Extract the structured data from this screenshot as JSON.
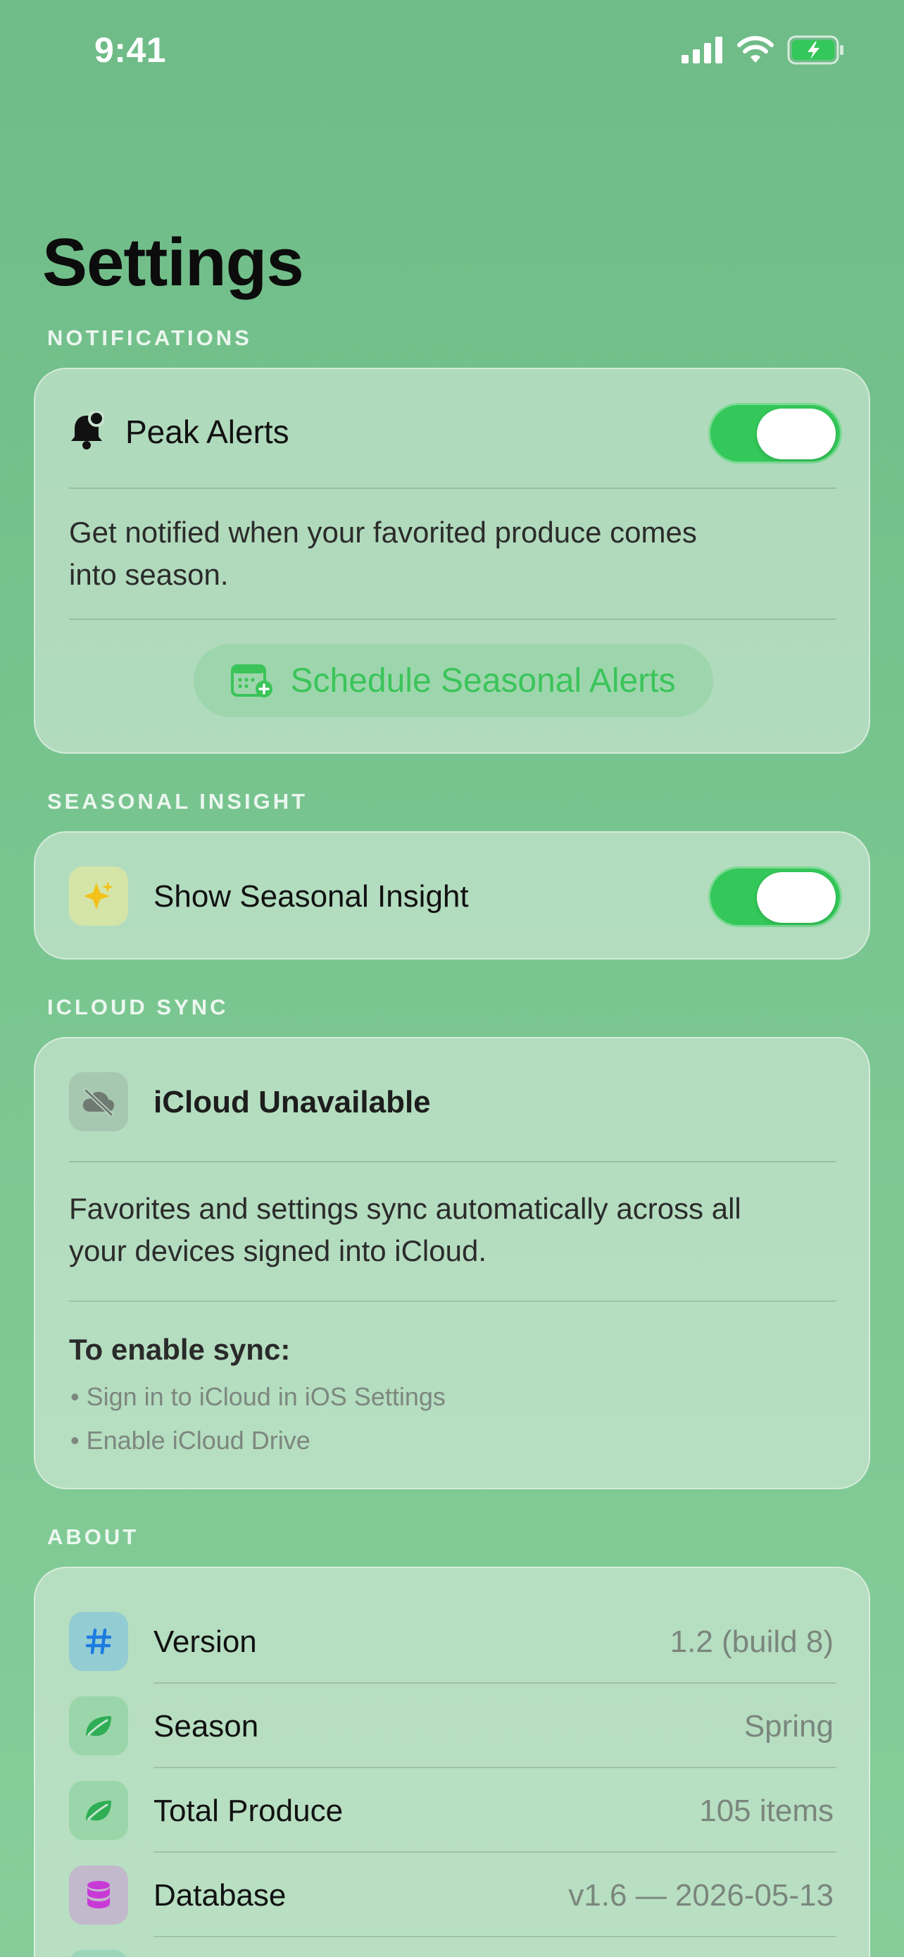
{
  "status_bar": {
    "time": "9:41"
  },
  "page": {
    "title": "Settings"
  },
  "colors": {
    "accent": "#34c759",
    "background": "#74c08c"
  },
  "notifications": {
    "header": "NOTIFICATIONS",
    "peak_alerts_label": "Peak Alerts",
    "peak_alerts_on": true,
    "description_line1": "Get notified when your favorited produce comes",
    "description_line2": "into season.",
    "schedule_button": "Schedule Seasonal Alerts"
  },
  "seasonal_insight": {
    "header": "SEASONAL INSIGHT",
    "label": "Show Seasonal Insight",
    "enabled": true
  },
  "icloud": {
    "header": "ICLOUD SYNC",
    "status": "iCloud Unavailable",
    "description_line1": "Favorites and settings sync automatically across all",
    "description_line2": "your devices signed into iCloud.",
    "enable_title": "To enable sync:",
    "steps": [
      "• Sign in to iCloud in iOS Settings",
      "• Enable iCloud Drive"
    ]
  },
  "about": {
    "header": "ABOUT",
    "rows": [
      {
        "label": "Version",
        "value": "1.2 (build 8)",
        "icon": "hash-icon"
      },
      {
        "label": "Season",
        "value": "Spring",
        "icon": "leaf-icon"
      },
      {
        "label": "Total Produce",
        "value": "105 items",
        "icon": "leaf-icon"
      },
      {
        "label": "Database",
        "value": "v1.6 — 2026-05-13",
        "icon": "database-icon"
      }
    ]
  }
}
